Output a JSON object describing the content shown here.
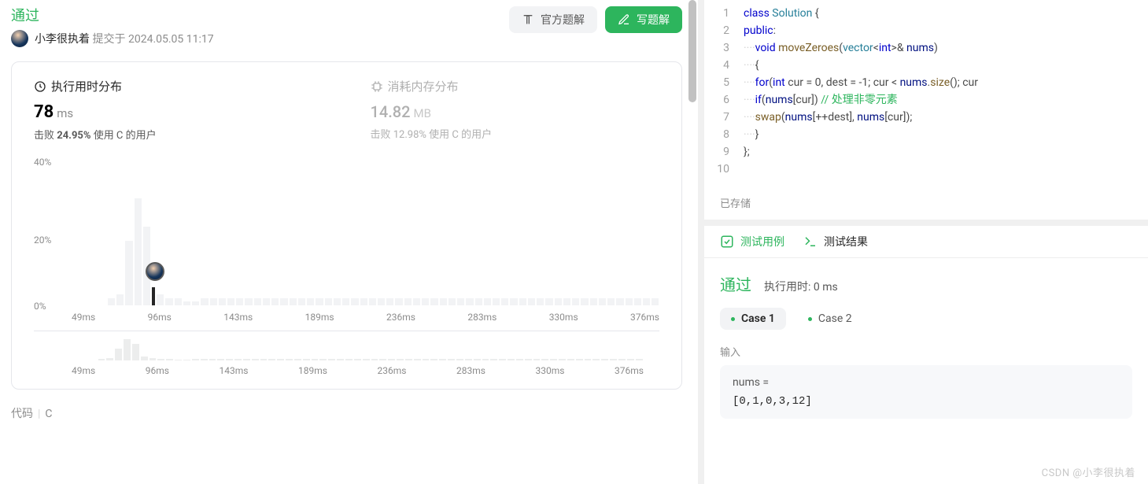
{
  "header": {
    "status": "通过",
    "user": "小李很执着",
    "submit_label": "提交于",
    "submit_time": "2024.05.05 11:17",
    "btn_official": "官方题解",
    "btn_write": "写题解"
  },
  "stats": {
    "runtime": {
      "title": "执行用时分布",
      "value": "78",
      "unit": "ms",
      "beat_prefix": "击败",
      "beat_pct": "24.95%",
      "beat_suffix": "使用 C 的用户"
    },
    "memory": {
      "title": "消耗内存分布",
      "value": "14.82",
      "unit": "MB",
      "beat_prefix": "击败",
      "beat_pct": "12.98%",
      "beat_suffix": "使用 C 的用户"
    }
  },
  "chart_data": {
    "type": "bar",
    "ylabel_pct": [
      "0%",
      "20%",
      "40%"
    ],
    "x_ticks": [
      "49ms",
      "96ms",
      "143ms",
      "189ms",
      "236ms",
      "283ms",
      "330ms",
      "376ms"
    ],
    "bars_pct": [
      0,
      0,
      0,
      0,
      2,
      3,
      18,
      30,
      22,
      5,
      3,
      2,
      2,
      1,
      1,
      2,
      2,
      2,
      2,
      2,
      2,
      2,
      2,
      2,
      2,
      2,
      2,
      2,
      2,
      2,
      2,
      2,
      2,
      2,
      2,
      2,
      2,
      2,
      2,
      2,
      2,
      2,
      2,
      2,
      2,
      2,
      2,
      2,
      2,
      2,
      2,
      2,
      2,
      2,
      2,
      2,
      2,
      2,
      2,
      2,
      2,
      2,
      2,
      2,
      2,
      2,
      2
    ],
    "highlight_index": 9,
    "brush_bars_pct": [
      0,
      0,
      0,
      2,
      3,
      15,
      26,
      20,
      5,
      3,
      2,
      2,
      1,
      1,
      2,
      2,
      2,
      2,
      2,
      2,
      2,
      2,
      2,
      2,
      2,
      2,
      2,
      2,
      2,
      2,
      2,
      2,
      2,
      2,
      2,
      2,
      2,
      2,
      2,
      2,
      2,
      2,
      2,
      2,
      2,
      2,
      2,
      2,
      2,
      2,
      2,
      2,
      2,
      2,
      2,
      2,
      2,
      2,
      2,
      2,
      2,
      2,
      2,
      2,
      2,
      2,
      2
    ]
  },
  "code_footer": {
    "label": "代码",
    "lang": "C"
  },
  "editor": {
    "lines": [
      {
        "n": "1",
        "tokens": [
          [
            "kw",
            "class "
          ],
          [
            "typ",
            "Solution"
          ],
          [
            "",
            " {"
          ]
        ]
      },
      {
        "n": "2",
        "tokens": [
          [
            "kw",
            "public"
          ],
          [
            "",
            ":"
          ]
        ]
      },
      {
        "n": "3",
        "tokens": [
          [
            "dots",
            "····"
          ],
          [
            "kw",
            "void "
          ],
          [
            "fn",
            "moveZeroes"
          ],
          [
            "",
            "("
          ],
          [
            "typ",
            "vector"
          ],
          [
            "",
            "<"
          ],
          [
            "kw",
            "int"
          ],
          [
            "",
            ">& "
          ],
          [
            "var",
            "nums"
          ],
          [
            "",
            ")"
          ]
        ]
      },
      {
        "n": "4",
        "tokens": [
          [
            "dots",
            "····"
          ],
          [
            "",
            "{"
          ]
        ]
      },
      {
        "n": "5",
        "tokens": [
          [
            "dots",
            "····"
          ],
          [
            "kw",
            "for"
          ],
          [
            "",
            "("
          ],
          [
            "kw",
            "int"
          ],
          [
            "",
            " cur = "
          ],
          [
            "",
            "0"
          ],
          [
            "",
            ", dest = -"
          ],
          [
            "",
            "1"
          ],
          [
            "",
            "; cur < "
          ],
          [
            "var",
            "nums"
          ],
          [
            "",
            "."
          ],
          [
            "fn",
            "size"
          ],
          [
            "",
            "(); cur"
          ]
        ]
      },
      {
        "n": "6",
        "tokens": [
          [
            "dots",
            "····"
          ],
          [
            "kw",
            "if"
          ],
          [
            "",
            "("
          ],
          [
            "var",
            "nums"
          ],
          [
            "",
            "[cur]) "
          ],
          [
            "com",
            "// 处理非零元素"
          ]
        ]
      },
      {
        "n": "7",
        "tokens": [
          [
            "dots",
            "····"
          ],
          [
            "fn",
            "swap"
          ],
          [
            "",
            "("
          ],
          [
            "var",
            "nums"
          ],
          [
            "",
            "[++dest], "
          ],
          [
            "var",
            "nums"
          ],
          [
            "",
            "[cur]);"
          ]
        ]
      },
      {
        "n": "8",
        "tokens": [
          [
            "dots",
            "····"
          ],
          [
            "",
            "}"
          ]
        ]
      },
      {
        "n": "9",
        "tokens": [
          [
            "",
            "};"
          ]
        ]
      },
      {
        "n": "10",
        "tokens": [
          [
            "",
            ""
          ]
        ]
      }
    ]
  },
  "saved_text": "已存储",
  "tabs": {
    "cases": "测试用例",
    "results": "测试结果"
  },
  "results": {
    "pass": "通过",
    "time_label": "执行用时: 0 ms",
    "cases": [
      "Case 1",
      "Case 2"
    ],
    "input_label": "输入",
    "input_key": "nums =",
    "input_val": "[0,1,0,3,12]"
  },
  "watermark": "CSDN @小李很执着"
}
